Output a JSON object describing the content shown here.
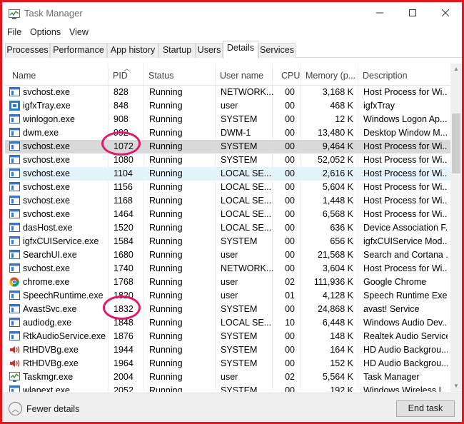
{
  "window": {
    "title": "Task Manager",
    "controls": {
      "minimize": "—",
      "maximize": "☐",
      "close": "✕"
    }
  },
  "menu": [
    "File",
    "Options",
    "View"
  ],
  "tabs": [
    {
      "label": "Processes",
      "active": false
    },
    {
      "label": "Performance",
      "active": false
    },
    {
      "label": "App history",
      "active": false
    },
    {
      "label": "Startup",
      "active": false
    },
    {
      "label": "Users",
      "active": false
    },
    {
      "label": "Details",
      "active": true
    },
    {
      "label": "Services",
      "active": false
    }
  ],
  "columns": {
    "name": "Name",
    "pid": "PID",
    "status": "Status",
    "user": "User name",
    "cpu": "CPU",
    "memory": "Memory (p...",
    "description": "Description"
  },
  "sorted_column": "pid",
  "rows": [
    {
      "name": "svchost.exe",
      "pid": "828",
      "status": "Running",
      "user": "NETWORK...",
      "cpu": "00",
      "mem": "3,168 K",
      "desc": "Host Process for Wi...",
      "icon": "service-icon",
      "state": ""
    },
    {
      "name": "igfxTray.exe",
      "pid": "848",
      "status": "Running",
      "user": "user",
      "cpu": "00",
      "mem": "468 K",
      "desc": "igfxTray",
      "icon": "intel-tray-icon",
      "state": ""
    },
    {
      "name": "winlogon.exe",
      "pid": "908",
      "status": "Running",
      "user": "SYSTEM",
      "cpu": "00",
      "mem": "12 K",
      "desc": "Windows Logon Ap...",
      "icon": "generic-app-icon",
      "state": ""
    },
    {
      "name": "dwm.exe",
      "pid": "992",
      "status": "Running",
      "user": "DWM-1",
      "cpu": "00",
      "mem": "13,480 K",
      "desc": "Desktop Window M...",
      "icon": "generic-app-icon",
      "state": ""
    },
    {
      "name": "svchost.exe",
      "pid": "1072",
      "status": "Running",
      "user": "SYSTEM",
      "cpu": "00",
      "mem": "9,464 K",
      "desc": "Host Process for Wi...",
      "icon": "service-icon",
      "state": "selected"
    },
    {
      "name": "svchost.exe",
      "pid": "1080",
      "status": "Running",
      "user": "SYSTEM",
      "cpu": "00",
      "mem": "52,052 K",
      "desc": "Host Process for Wi...",
      "icon": "service-icon",
      "state": ""
    },
    {
      "name": "svchost.exe",
      "pid": "1104",
      "status": "Running",
      "user": "LOCAL SE...",
      "cpu": "00",
      "mem": "2,616 K",
      "desc": "Host Process for Wi...",
      "icon": "service-icon",
      "state": "hover"
    },
    {
      "name": "svchost.exe",
      "pid": "1156",
      "status": "Running",
      "user": "LOCAL SE...",
      "cpu": "00",
      "mem": "5,604 K",
      "desc": "Host Process for Wi...",
      "icon": "service-icon",
      "state": ""
    },
    {
      "name": "svchost.exe",
      "pid": "1168",
      "status": "Running",
      "user": "LOCAL SE...",
      "cpu": "00",
      "mem": "1,448 K",
      "desc": "Host Process for Wi...",
      "icon": "service-icon",
      "state": ""
    },
    {
      "name": "svchost.exe",
      "pid": "1464",
      "status": "Running",
      "user": "LOCAL SE...",
      "cpu": "00",
      "mem": "6,568 K",
      "desc": "Host Process for Wi...",
      "icon": "service-icon",
      "state": ""
    },
    {
      "name": "dasHost.exe",
      "pid": "1520",
      "status": "Running",
      "user": "LOCAL SE...",
      "cpu": "00",
      "mem": "636 K",
      "desc": "Device Association F...",
      "icon": "generic-app-icon",
      "state": ""
    },
    {
      "name": "igfxCUIService.exe",
      "pid": "1584",
      "status": "Running",
      "user": "SYSTEM",
      "cpu": "00",
      "mem": "656 K",
      "desc": "igfxCUIService Mod...",
      "icon": "generic-app-icon",
      "state": ""
    },
    {
      "name": "SearchUI.exe",
      "pid": "1680",
      "status": "Running",
      "user": "user",
      "cpu": "00",
      "mem": "21,568 K",
      "desc": "Search and Cortana ...",
      "icon": "generic-app-icon",
      "state": ""
    },
    {
      "name": "svchost.exe",
      "pid": "1740",
      "status": "Running",
      "user": "NETWORK...",
      "cpu": "00",
      "mem": "3,604 K",
      "desc": "Host Process for Wi...",
      "icon": "service-icon",
      "state": ""
    },
    {
      "name": "chrome.exe",
      "pid": "1768",
      "status": "Running",
      "user": "user",
      "cpu": "02",
      "mem": "111,936 K",
      "desc": "Google Chrome",
      "icon": "chrome-icon",
      "state": ""
    },
    {
      "name": "SpeechRuntime.exe",
      "pid": "1820",
      "status": "Running",
      "user": "user",
      "cpu": "01",
      "mem": "4,128 K",
      "desc": "Speech Runtime Exe...",
      "icon": "generic-app-icon",
      "state": ""
    },
    {
      "name": "AvastSvc.exe",
      "pid": "1832",
      "status": "Running",
      "user": "SYSTEM",
      "cpu": "00",
      "mem": "24,868 K",
      "desc": "avast! Service",
      "icon": "generic-app-icon",
      "state": ""
    },
    {
      "name": "audiodg.exe",
      "pid": "1848",
      "status": "Running",
      "user": "LOCAL SE...",
      "cpu": "10",
      "mem": "6,448 K",
      "desc": "Windows Audio Dev...",
      "icon": "generic-app-icon",
      "state": ""
    },
    {
      "name": "RtkAudioService.exe",
      "pid": "1876",
      "status": "Running",
      "user": "SYSTEM",
      "cpu": "00",
      "mem": "148 K",
      "desc": "Realtek Audio Service",
      "icon": "generic-app-icon",
      "state": ""
    },
    {
      "name": "RtHDVBg.exe",
      "pid": "1944",
      "status": "Running",
      "user": "SYSTEM",
      "cpu": "00",
      "mem": "164 K",
      "desc": "HD Audio Backgrou...",
      "icon": "speaker-icon",
      "state": ""
    },
    {
      "name": "RtHDVBg.exe",
      "pid": "1964",
      "status": "Running",
      "user": "SYSTEM",
      "cpu": "00",
      "mem": "152 K",
      "desc": "HD Audio Backgrou...",
      "icon": "speaker-icon",
      "state": ""
    },
    {
      "name": "Taskmgr.exe",
      "pid": "2004",
      "status": "Running",
      "user": "user",
      "cpu": "02",
      "mem": "5,564 K",
      "desc": "Task Manager",
      "icon": "task-manager-icon",
      "state": ""
    },
    {
      "name": "wlanext.exe",
      "pid": "2052",
      "status": "Running",
      "user": "SYSTEM",
      "cpu": "00",
      "mem": "192 K",
      "desc": "Windows Wireless L...",
      "icon": "generic-app-icon",
      "state": ""
    }
  ],
  "annotations": [
    "1072",
    "1832"
  ],
  "footer": {
    "fewer_details": "Fewer details",
    "end_task": "End task"
  },
  "colors": {
    "frame_border": "#e8141c",
    "annotation_circle": "#e0196a",
    "selected_row": "#d9d9d9",
    "hover_row": "#e5f3fb"
  }
}
